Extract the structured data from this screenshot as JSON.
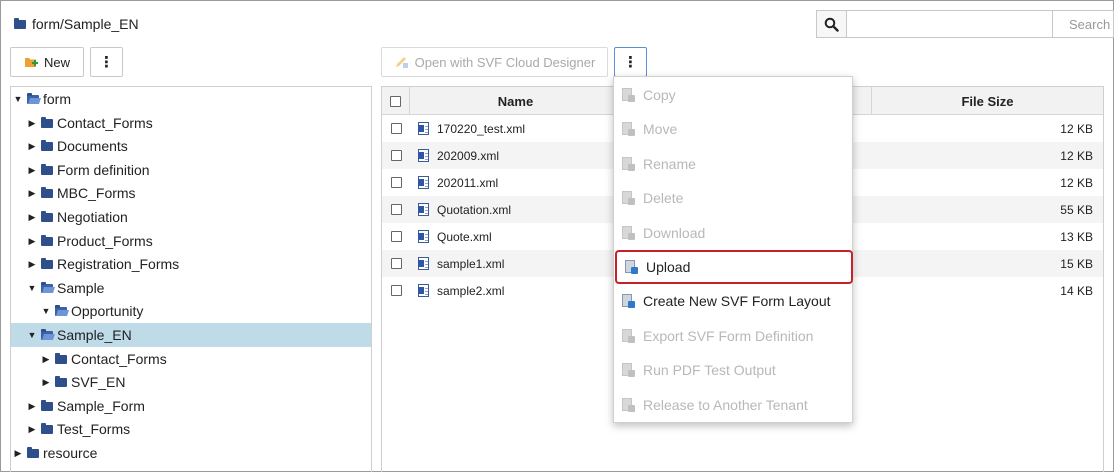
{
  "header": {
    "path": "form/Sample_EN",
    "search_placeholder": "",
    "search_button": "Search"
  },
  "toolbar": {
    "new_label": "New",
    "more_label": "⋮",
    "open_designer_label": "Open with SVF Cloud Designer",
    "actions_label": "⋮"
  },
  "tree": [
    {
      "label": "form",
      "level": 0,
      "state": "expanded",
      "selected": false
    },
    {
      "label": "Contact_Forms",
      "level": 1,
      "state": "collapsed",
      "selected": false
    },
    {
      "label": "Documents",
      "level": 1,
      "state": "collapsed",
      "selected": false
    },
    {
      "label": "Form definition",
      "level": 1,
      "state": "collapsed",
      "selected": false
    },
    {
      "label": "MBC_Forms",
      "level": 1,
      "state": "collapsed",
      "selected": false
    },
    {
      "label": "Negotiation",
      "level": 1,
      "state": "collapsed",
      "selected": false
    },
    {
      "label": "Product_Forms",
      "level": 1,
      "state": "collapsed",
      "selected": false
    },
    {
      "label": "Registration_Forms",
      "level": 1,
      "state": "collapsed",
      "selected": false
    },
    {
      "label": "Sample",
      "level": 1,
      "state": "expanded",
      "selected": false
    },
    {
      "label": "Opportunity",
      "level": 2,
      "state": "expanded",
      "selected": false
    },
    {
      "label": "Sample_EN",
      "level": 1,
      "state": "expanded",
      "selected": true
    },
    {
      "label": "Contact_Forms",
      "level": 2,
      "state": "collapsed",
      "selected": false
    },
    {
      "label": "SVF_EN",
      "level": 2,
      "state": "collapsed",
      "selected": false
    },
    {
      "label": "Sample_Form",
      "level": 1,
      "state": "collapsed",
      "selected": false
    },
    {
      "label": "Test_Forms",
      "level": 1,
      "state": "collapsed",
      "selected": false
    },
    {
      "label": "resource",
      "level": 0,
      "state": "collapsed",
      "selected": false
    }
  ],
  "table": {
    "columns": [
      "Name",
      "File Size"
    ],
    "rows": [
      {
        "name": "170220_test.xml",
        "size": "12 KB"
      },
      {
        "name": "202009.xml",
        "size": "12 KB"
      },
      {
        "name": "202011.xml",
        "size": "12 KB"
      },
      {
        "name": "Quotation.xml",
        "size": "55 KB"
      },
      {
        "name": "Quote.xml",
        "size": "13 KB"
      },
      {
        "name": "sample1.xml",
        "size": "15 KB"
      },
      {
        "name": "sample2.xml",
        "size": "14 KB"
      }
    ]
  },
  "menu": {
    "items": [
      {
        "label": "Copy",
        "enabled": false,
        "highlight": false,
        "icon": "copy-icon"
      },
      {
        "label": "Move",
        "enabled": false,
        "highlight": false,
        "icon": "move-icon"
      },
      {
        "label": "Rename",
        "enabled": false,
        "highlight": false,
        "icon": "rename-icon"
      },
      {
        "label": "Delete",
        "enabled": false,
        "highlight": false,
        "icon": "delete-icon"
      },
      {
        "label": "Download",
        "enabled": false,
        "highlight": false,
        "icon": "download-icon"
      },
      {
        "label": "Upload",
        "enabled": true,
        "highlight": true,
        "icon": "upload-icon"
      },
      {
        "label": "Create New SVF Form Layout",
        "enabled": true,
        "highlight": false,
        "icon": "create-layout-icon"
      },
      {
        "label": "Export SVF Form Definition",
        "enabled": false,
        "highlight": false,
        "icon": "export-icon"
      },
      {
        "label": "Run PDF Test Output",
        "enabled": false,
        "highlight": false,
        "icon": "print-icon"
      },
      {
        "label": "Release to Another Tenant",
        "enabled": false,
        "highlight": false,
        "icon": "release-icon"
      }
    ]
  },
  "colors": {
    "selection": "#bfdbe8",
    "highlight_border": "#c8202a",
    "folder": "#2f4f8a"
  }
}
